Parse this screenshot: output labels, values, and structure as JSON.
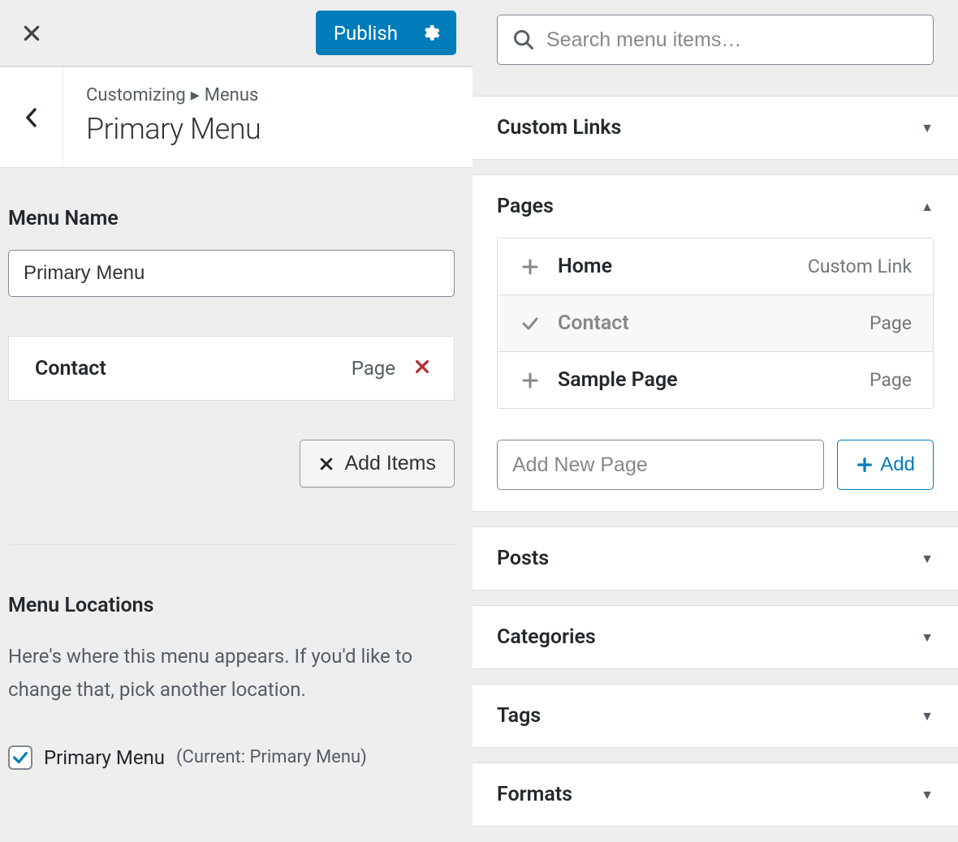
{
  "header": {
    "publish_label": "Publish",
    "breadcrumb_root": "Customizing",
    "breadcrumb_section": "Menus",
    "page_title": "Primary Menu"
  },
  "menu": {
    "name_label": "Menu Name",
    "name_value": "Primary Menu",
    "items": [
      {
        "title": "Contact",
        "type": "Page"
      }
    ],
    "add_items_label": "Add Items"
  },
  "locations": {
    "heading": "Menu Locations",
    "description": "Here's where this menu appears. If you'd like to change that, pick another location.",
    "options": [
      {
        "label": "Primary Menu",
        "sublabel": "(Current: Primary Menu)",
        "checked": true
      }
    ]
  },
  "search": {
    "placeholder": "Search menu items…"
  },
  "accordions": {
    "custom_links": "Custom Links",
    "pages": "Pages",
    "posts": "Posts",
    "categories": "Categories",
    "tags": "Tags",
    "formats": "Formats"
  },
  "pages": {
    "items": [
      {
        "title": "Home",
        "type": "Custom Link",
        "added": false
      },
      {
        "title": "Contact",
        "type": "Page",
        "added": true
      },
      {
        "title": "Sample Page",
        "type": "Page",
        "added": false
      }
    ],
    "new_page_placeholder": "Add New Page",
    "add_button": "Add"
  }
}
